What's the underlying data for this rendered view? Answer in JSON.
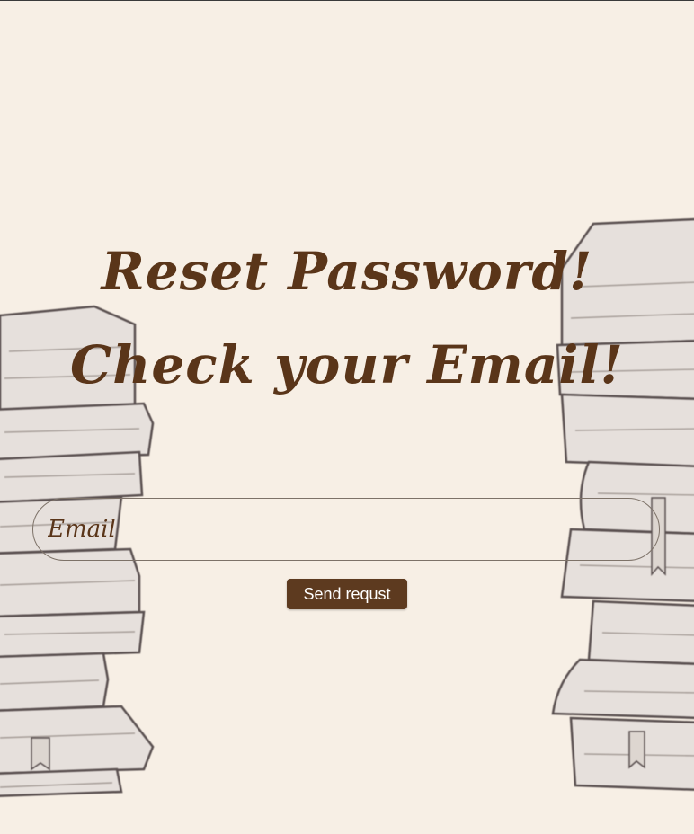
{
  "page": {
    "heading_line1": "Reset Password!",
    "heading_line2": "Check your Email!"
  },
  "form": {
    "email_placeholder": "Email",
    "email_value": "",
    "submit_label": "Send requst"
  },
  "colors": {
    "background": "#f7efe5",
    "heading_text": "#5a3519",
    "button_bg": "#5d3a1f",
    "button_text": "#ffffff",
    "field_border": "#7d7268"
  },
  "decorations": {
    "left_illustration": "book-stack-left",
    "right_illustration": "book-stack-right"
  }
}
